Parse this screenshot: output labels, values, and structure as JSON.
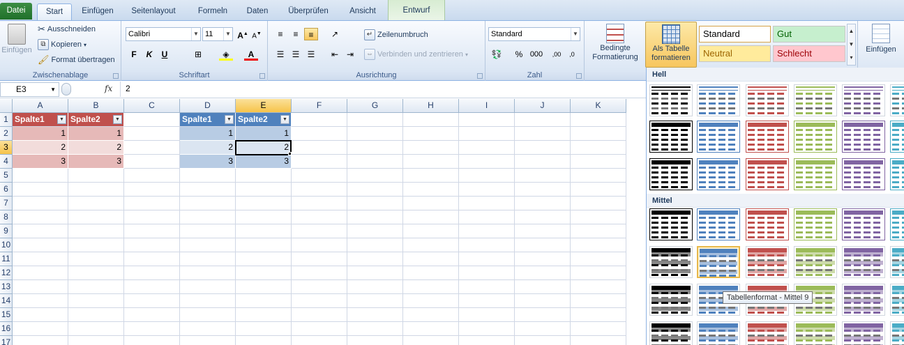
{
  "tabs": [
    "Datei",
    "Start",
    "Einfügen",
    "Seitenlayout",
    "Formeln",
    "Daten",
    "Überprüfen",
    "Ansicht",
    "Entwurf"
  ],
  "clipboard": {
    "paste": "Einfügen",
    "cut": "Ausschneiden",
    "copy": "Kopieren",
    "format_painter": "Format übertragen",
    "label": "Zwischenablage"
  },
  "font": {
    "name": "Calibri",
    "size": "11",
    "bold": "F",
    "italic": "K",
    "underline": "U",
    "label": "Schriftart"
  },
  "alignment": {
    "wrap": "Zeilenumbruch",
    "merge": "Verbinden und zentrieren",
    "label": "Ausrichtung"
  },
  "number": {
    "format": "Standard",
    "percent": "%",
    "thousands": "000",
    "label": "Zahl"
  },
  "styles": {
    "conditional": [
      "Bedingte",
      "Formatierung"
    ],
    "as_table": [
      "Als Tabelle",
      "formatieren"
    ],
    "cells": [
      "Standard",
      "Gut",
      "Neutral",
      "Schlecht"
    ]
  },
  "cells": {
    "insert": "Einfügen"
  },
  "formula_bar": {
    "name_box": "E3",
    "fx": "fx",
    "content": "2"
  },
  "columns": [
    "A",
    "B",
    "C",
    "D",
    "E",
    "F",
    "G",
    "H",
    "I",
    "J",
    "K"
  ],
  "rows": [
    "1",
    "2",
    "3",
    "4",
    "5",
    "6",
    "7",
    "8",
    "9",
    "10",
    "11",
    "12",
    "13",
    "14",
    "15",
    "16",
    "17"
  ],
  "table_red": {
    "headers": [
      "Spalte1",
      "Spalte2"
    ],
    "rows": [
      [
        "1",
        "1"
      ],
      [
        "2",
        "2"
      ],
      [
        "3",
        "3"
      ]
    ]
  },
  "table_blue": {
    "headers": [
      "Spalte1",
      "Spalte2"
    ],
    "rows": [
      [
        "1",
        "1"
      ],
      [
        "2",
        "2"
      ],
      [
        "3",
        "3"
      ]
    ]
  },
  "gallery": {
    "sections": [
      "Hell",
      "Mittel"
    ],
    "tooltip": "Tabellenformat - Mittel 9"
  },
  "colors": {
    "red_header": "#c0504d",
    "blue_header": "#4f81bd",
    "selected_header": "#f6c34a"
  }
}
